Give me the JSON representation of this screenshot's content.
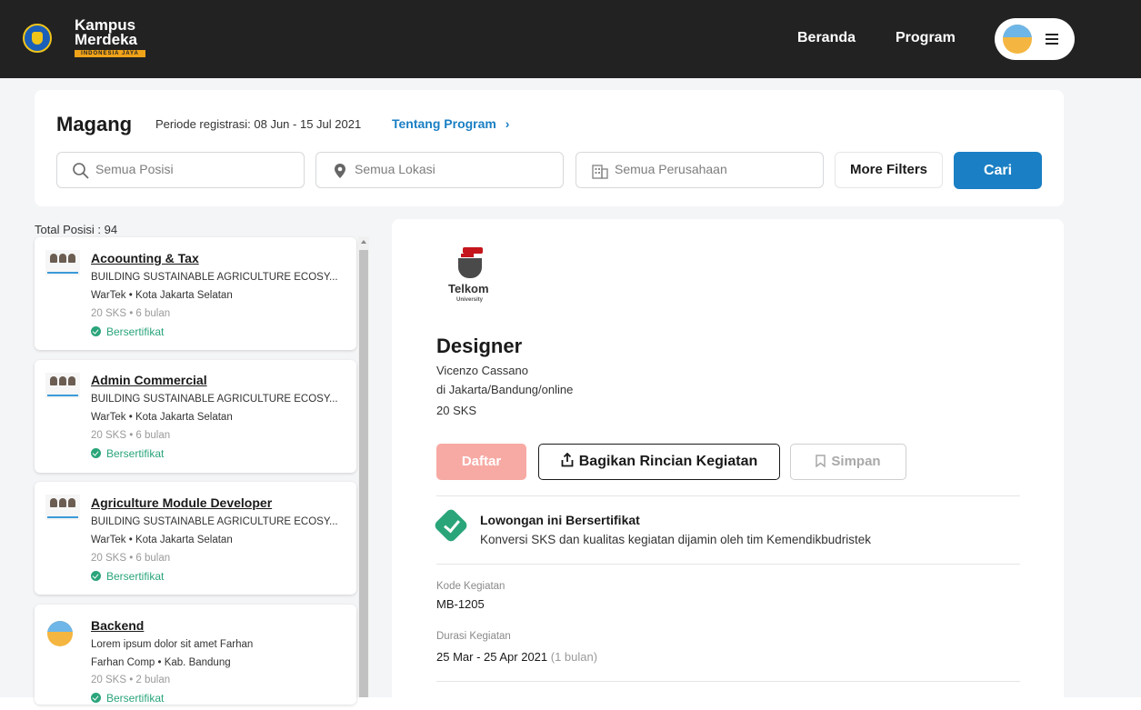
{
  "header": {
    "brand_line1": "Kampus",
    "brand_line2": "Merdeka",
    "brand_tag": "INDONESIA JAYA",
    "nav": [
      "Beranda",
      "Program"
    ]
  },
  "search": {
    "title": "Magang",
    "period": "Periode registrasi: 08 Jun - 15 Jul 2021",
    "about_link": "Tentang Program",
    "position_placeholder": "Semua Posisi",
    "location_placeholder": "Semua Lokasi",
    "company_placeholder": "Semua Perusahaan",
    "more_filters": "More Filters",
    "search_button": "Cari"
  },
  "list": {
    "total": "Total Posisi : 94",
    "jobs": [
      {
        "title": "Acoounting & Tax",
        "desc": "BUILDING SUSTAINABLE AGRICULTURE ECOSY...",
        "company": "WarTek • Kota Jakarta Selatan",
        "meta": "20 SKS • 6 bulan",
        "cert": "Bersertifikat"
      },
      {
        "title": "Admin Commercial",
        "desc": "BUILDING SUSTAINABLE AGRICULTURE ECOSY...",
        "company": "WarTek • Kota Jakarta Selatan",
        "meta": "20 SKS • 6 bulan",
        "cert": "Bersertifikat"
      },
      {
        "title": "Agriculture Module Developer",
        "desc": "BUILDING SUSTAINABLE AGRICULTURE ECOSY...",
        "company": "WarTek • Kota Jakarta Selatan",
        "meta": "20 SKS • 6 bulan",
        "cert": "Bersertifikat"
      },
      {
        "title": "Backend",
        "desc": "Lorem ipsum dolor sit amet Farhan",
        "company": "Farhan Comp • Kab. Bandung",
        "meta": "20 SKS • 2 bulan",
        "cert": "Bersertifikat"
      }
    ]
  },
  "detail": {
    "logo_word": "Telkom",
    "logo_sub": "University",
    "title": "Designer",
    "mentor": "Vicenzo Cassano",
    "location": "di Jakarta/Bandung/online",
    "sks": "20 SKS",
    "apply": "Daftar",
    "share": "Bagikan Rincian Kegiatan",
    "save": "Simpan",
    "cert_title": "Lowongan ini Bersertifikat",
    "cert_desc": "Konversi SKS dan kualitas kegiatan dijamin oleh tim Kemendikbudristek",
    "code_label": "Kode Kegiatan",
    "code_value": "MB-1205",
    "duration_label": "Durasi Kegiatan",
    "duration_value": "25 Mar - 25 Apr 2021",
    "duration_extra": "(1 bulan)"
  },
  "colors": {
    "accent": "#1a7fc4",
    "topbar": "#222222",
    "certified": "#2aa57a",
    "apply_disabled": "#f7aaa4"
  }
}
